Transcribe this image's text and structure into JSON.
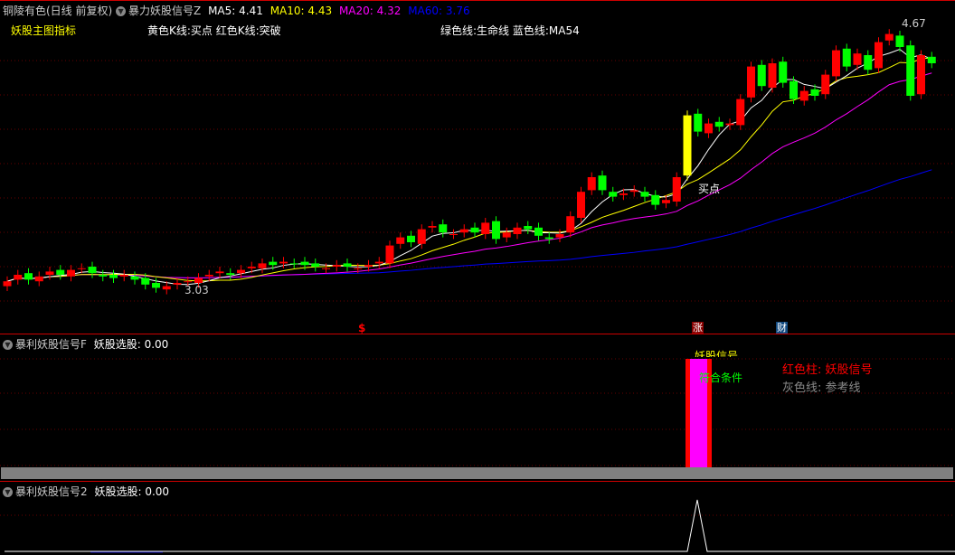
{
  "header": {
    "stock": "铜陵有色(日线 前复权)",
    "indicator": "暴力妖股信号Z",
    "ma5": "MA5: 4.41",
    "ma10": "MA10: 4.43",
    "ma20": "MA20: 4.32",
    "ma60": "MA60: 3.76"
  },
  "legend": {
    "main": "妖股主图指标",
    "kline": "黄色K线:买点  红色K线:突破",
    "lines": "绿色线:生命线  蓝色线:MA54"
  },
  "labels": {
    "high": "4.67",
    "low": "3.03",
    "buy": "买点",
    "dollar": "$",
    "zhang": "涨",
    "cai": "财"
  },
  "panel2": {
    "title": "暴利妖股信号F",
    "value": "妖股选股: 0.00",
    "clipped": "妖股信号",
    "cond": "符合条件",
    "red_legend": "红色柱: 妖股信号",
    "gray_legend": "灰色线: 参考线"
  },
  "panel3": {
    "title": "暴利妖股信号2",
    "value": "妖股选股: 0.00"
  },
  "colors": {
    "up": "#ff0000",
    "down": "#00ff00",
    "ma5": "#ffffff",
    "ma10": "#ffff00",
    "ma20": "#ff00ff",
    "ma60": "#0000ff"
  },
  "closes": [
    3.08,
    3.12,
    3.09,
    3.11,
    3.14,
    3.12,
    3.15,
    3.16,
    3.13,
    3.11,
    3.1,
    3.12,
    3.09,
    3.06,
    3.04,
    3.05,
    3.07,
    3.08,
    3.1,
    3.12,
    3.14,
    3.12,
    3.15,
    3.17,
    3.19,
    3.18,
    3.2,
    3.19,
    3.18,
    3.17,
    3.16,
    3.18,
    3.17,
    3.16,
    3.18,
    3.2,
    3.3,
    3.35,
    3.32,
    3.4,
    3.42,
    3.38,
    3.37,
    3.4,
    3.38,
    3.44,
    3.34,
    3.38,
    3.41,
    3.4,
    3.36,
    3.34,
    3.37,
    3.48,
    3.63,
    3.72,
    3.64,
    3.6,
    3.62,
    3.64,
    3.6,
    3.55,
    3.58,
    3.72,
    4.1,
    4.0,
    4.05,
    4.03,
    4.05,
    4.2,
    4.4,
    4.28,
    4.42,
    4.3,
    4.2,
    4.25,
    4.22,
    4.35,
    4.5,
    4.4,
    4.48,
    4.38,
    4.55,
    4.6,
    4.52,
    4.22,
    4.47,
    4.42
  ]
}
